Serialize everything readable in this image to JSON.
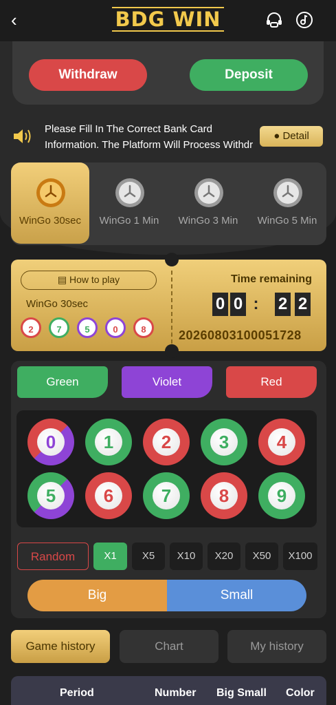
{
  "header": {
    "brand": "BDG WIN"
  },
  "wallet": {
    "withdraw_label": "Withdraw",
    "deposit_label": "Deposit"
  },
  "notice": {
    "text": "Please Fill In The Correct Bank Card Information. The Platform Will Process Withdr",
    "detail_label": "Detail"
  },
  "game_tabs": [
    {
      "label": "WinGo 30sec",
      "active": true
    },
    {
      "label": "WinGo 1 Min",
      "active": false
    },
    {
      "label": "WinGo 3 Min",
      "active": false
    },
    {
      "label": "WinGo 5 Min",
      "active": false
    }
  ],
  "game_info": {
    "how_to_play": "How to play",
    "game_name": "WinGo 30sec",
    "recent_results": [
      "2",
      "7",
      "5",
      "0",
      "8"
    ],
    "time_label": "Time remaining",
    "time_digits": [
      "0",
      "0",
      ":",
      "2",
      "2"
    ],
    "period": "2026080310005172​8"
  },
  "colors_bet": {
    "green": "Green",
    "violet": "Violet",
    "red": "Red"
  },
  "numbers": [
    "0",
    "1",
    "2",
    "3",
    "4",
    "5",
    "6",
    "7",
    "8",
    "9"
  ],
  "multipliers": {
    "random": "Random",
    "options": [
      "X1",
      "X5",
      "X10",
      "X20",
      "X50",
      "X100"
    ],
    "selected": "X1"
  },
  "big_small": {
    "big": "Big",
    "small": "Small"
  },
  "history_tabs": {
    "game_history": "Game history",
    "chart": "Chart",
    "my_history": "My history"
  },
  "table_headers": {
    "period": "Period",
    "number": "Number",
    "big_small": "Big Small",
    "color": "Color"
  },
  "palette": {
    "gold": "#f2c94c",
    "red": "#d94848",
    "green": "#3fae61",
    "violet": "#8e44d6",
    "blue": "#5a8fd9",
    "orange": "#e39c44"
  }
}
